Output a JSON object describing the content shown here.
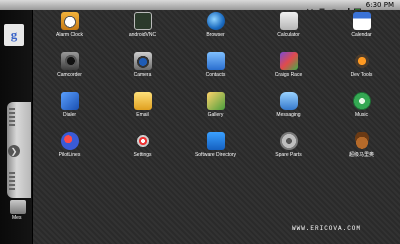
{
  "status_bar": {
    "time": "6:30 PM",
    "icons": [
      "usb-icon",
      "sd-card-icon",
      "wifi-icon",
      "signal-icon",
      "battery-icon"
    ]
  },
  "home_panel": {
    "search_logo": "g",
    "partial_label": "Mes"
  },
  "apps": [
    {
      "label": "Alarm Clock",
      "icon": "alarm-clock-icon"
    },
    {
      "label": "androidVNC",
      "icon": "vnc-icon"
    },
    {
      "label": "Browser",
      "icon": "browser-globe-icon"
    },
    {
      "label": "Calculator",
      "icon": "calculator-icon"
    },
    {
      "label": "Calendar",
      "icon": "calendar-icon"
    },
    {
      "label": "Camcorder",
      "icon": "camcorder-icon"
    },
    {
      "label": "Camera",
      "icon": "camera-icon"
    },
    {
      "label": "Contacts",
      "icon": "contacts-icon"
    },
    {
      "label": "Craigs Race",
      "icon": "craigs-race-icon"
    },
    {
      "label": "Dev Tools",
      "icon": "dev-tools-gear-icon"
    },
    {
      "label": "Dialer",
      "icon": "dialer-phone-icon"
    },
    {
      "label": "Email",
      "icon": "email-envelope-icon"
    },
    {
      "label": "Gallery",
      "icon": "gallery-photos-icon"
    },
    {
      "label": "Messaging",
      "icon": "messaging-bubble-icon"
    },
    {
      "label": "Music",
      "icon": "music-note-icon"
    },
    {
      "label": "PilotLines",
      "icon": "pilotlines-icon"
    },
    {
      "label": "Settings",
      "icon": "settings-icon"
    },
    {
      "label": "Software Directory",
      "icon": "software-directory-icon"
    },
    {
      "label": "Spare Parts",
      "icon": "spare-parts-gear-icon"
    },
    {
      "label": "超级马里奥",
      "icon": "mario-mushroom-icon"
    }
  ],
  "watermark": "WWW.ERICOVA.COM"
}
